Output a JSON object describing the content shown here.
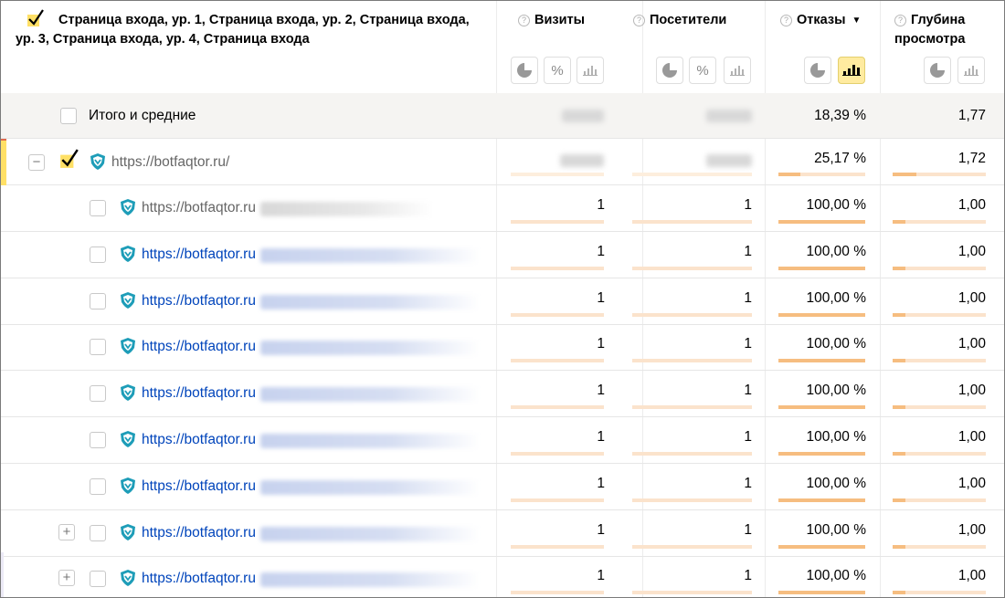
{
  "header": {
    "dimension_title": "Страница входа, ур. 1, Страница входа, ур. 2, Страница входа, ур. 3, Страница входа, ур. 4, Страница входа",
    "columns": [
      {
        "label": "Визиты",
        "help": "?"
      },
      {
        "label": "Посетители",
        "help": "?"
      },
      {
        "label": "Отказы",
        "help": "?",
        "sort": "▼"
      },
      {
        "label": "Глубина просмотра",
        "help": "?"
      }
    ],
    "tool_percent_symbol": "%"
  },
  "totals": {
    "label": "Итого и средние",
    "visits_hidden": "blurred",
    "visitors_hidden": "blurred",
    "bounce": "18,39 %",
    "depth": "1,77"
  },
  "group_row": {
    "expander": "−",
    "url": "https://botfaqtor.ru/",
    "bounce": "25,17 %",
    "bounce_fill": 0.25,
    "depth": "1,72",
    "depth_fill": 0.25
  },
  "rows": [
    {
      "url": "https://botfaqtor.ru",
      "visits": "1",
      "visitors": "1",
      "bounce": "100,00 %",
      "depth": "1,00",
      "visited": true
    },
    {
      "url": "https://botfaqtor.ru",
      "visits": "1",
      "visitors": "1",
      "bounce": "100,00 %",
      "depth": "1,00"
    },
    {
      "url": "https://botfaqtor.ru",
      "visits": "1",
      "visitors": "1",
      "bounce": "100,00 %",
      "depth": "1,00"
    },
    {
      "url": "https://botfaqtor.ru",
      "visits": "1",
      "visitors": "1",
      "bounce": "100,00 %",
      "depth": "1,00"
    },
    {
      "url": "https://botfaqtor.ru",
      "visits": "1",
      "visitors": "1",
      "bounce": "100,00 %",
      "depth": "1,00"
    },
    {
      "url": "https://botfaqtor.ru",
      "visits": "1",
      "visitors": "1",
      "bounce": "100,00 %",
      "depth": "1,00"
    },
    {
      "url": "https://botfaqtor.ru",
      "visits": "1",
      "visitors": "1",
      "bounce": "100,00 %",
      "depth": "1,00"
    },
    {
      "url": "https://botfaqtor.ru",
      "visits": "1",
      "visitors": "1",
      "bounce": "100,00 %",
      "depth": "1,00",
      "expander": "+"
    },
    {
      "url": "https://botfaqtor.ru",
      "visits": "1",
      "visitors": "1",
      "bounce": "100,00 %",
      "depth": "1,00",
      "expander": "+"
    }
  ],
  "colors": {
    "accent_yellow": "#ffe066",
    "bar_fill": "#f6bd80",
    "bar_track": "#fbe3cc",
    "link_blue": "#0044bb",
    "visited_grey": "#666666",
    "shield_teal": "#1e9db8"
  },
  "icons": [
    "checkmark-icon",
    "help-icon",
    "pie-chart-icon",
    "percent-icon",
    "bar-chart-icon",
    "shield-favicon-icon",
    "sort-desc-icon"
  ]
}
